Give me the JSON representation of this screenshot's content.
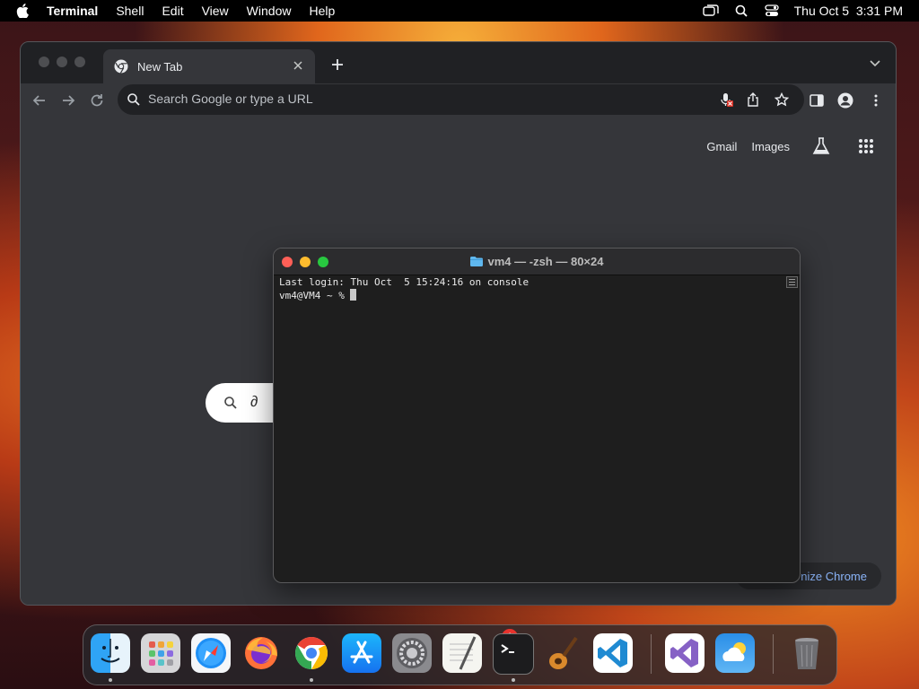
{
  "menubar": {
    "app_name": "Terminal",
    "items": [
      "Shell",
      "Edit",
      "View",
      "Window",
      "Help"
    ],
    "clock": "Thu Oct 5  3:31 PM"
  },
  "chrome": {
    "tab_title": "New Tab",
    "omnibox_placeholder": "Search Google or type a URL",
    "links": {
      "gmail": "Gmail",
      "images": "Images"
    },
    "customize_label": "nize Chrome",
    "search_pill_glyph": "∂"
  },
  "terminal": {
    "title": "vm4 — -zsh — 80×24",
    "lines": [
      "Last login: Thu Oct  5 15:24:16 on console",
      "vm4@VM4 ~ % "
    ]
  },
  "dock": {
    "apps": [
      "Finder",
      "Launchpad",
      "Safari",
      "Firefox",
      "Google Chrome",
      "App Store",
      "System Settings",
      "TextEdit",
      "Terminal",
      "GarageBand",
      "Visual Studio Code",
      "Visual Studio",
      "Weather",
      "Trash"
    ],
    "settings_badge": "1"
  },
  "colors": {
    "chrome_bg": "#35363a",
    "tabstrip_bg": "#202124",
    "terminal_bg": "#1e1e1e",
    "link_blue": "#8ab4f8"
  }
}
